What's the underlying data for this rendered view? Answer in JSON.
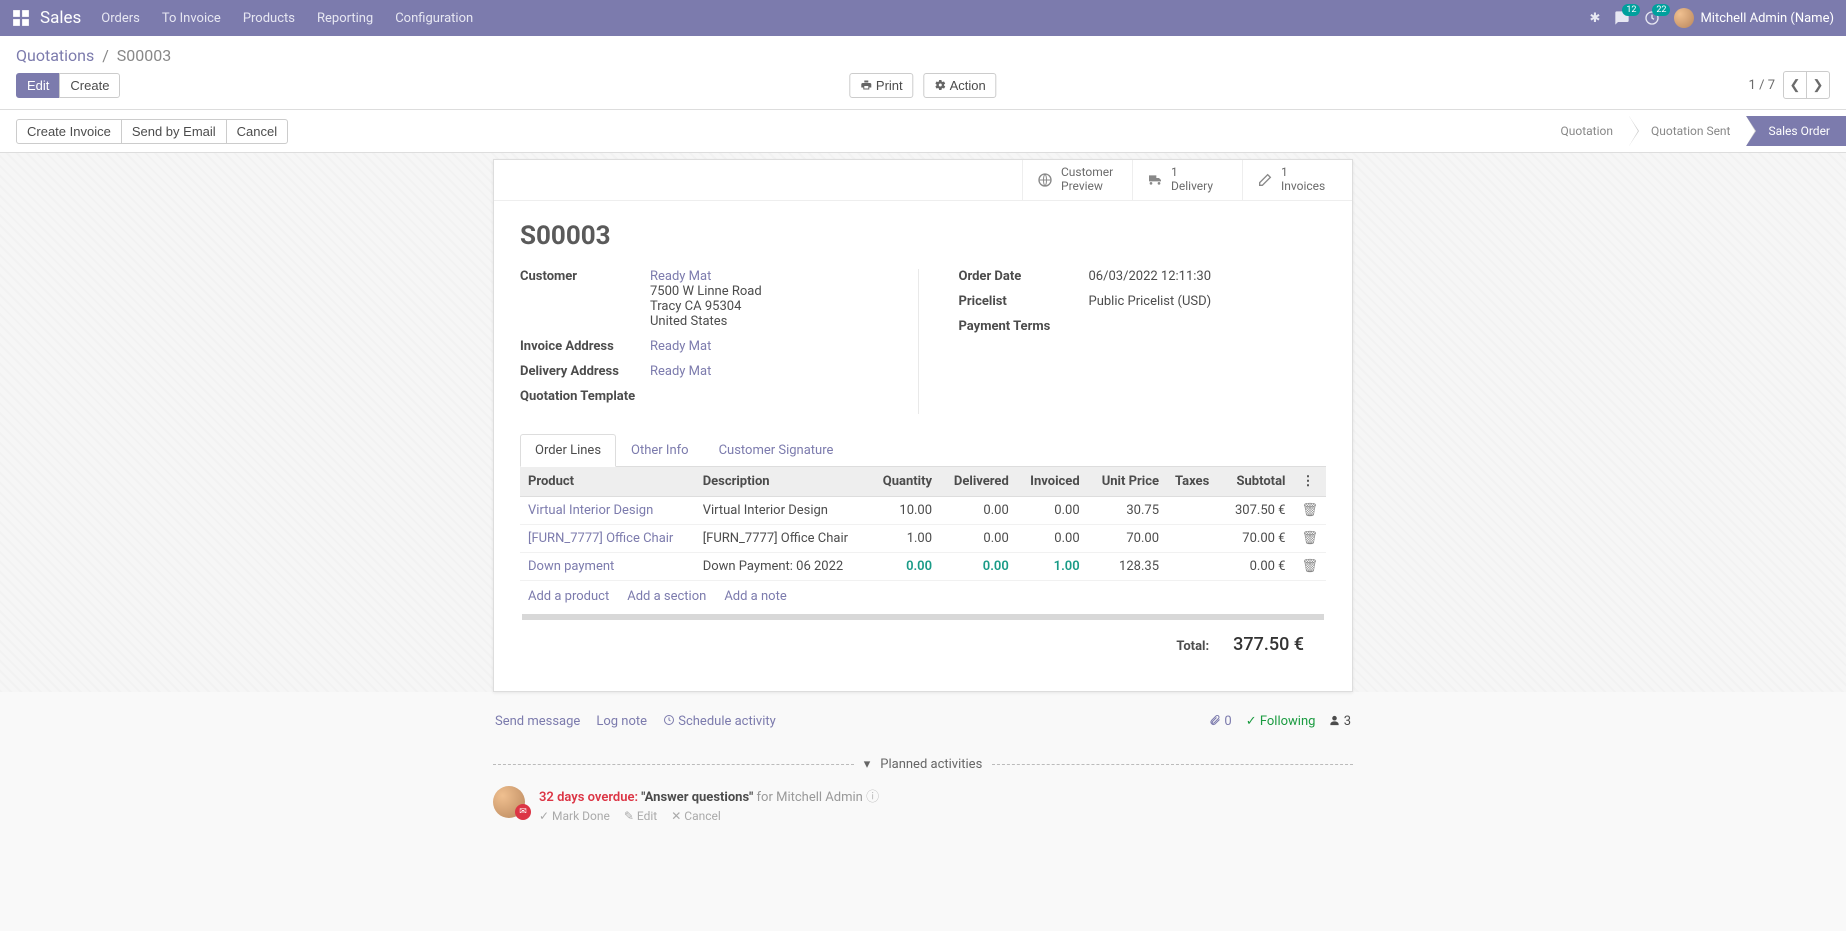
{
  "nav": {
    "brand": "Sales",
    "menu": [
      "Orders",
      "To Invoice",
      "Products",
      "Reporting",
      "Configuration"
    ],
    "msg_count": "12",
    "act_count": "22",
    "user": "Mitchell Admin (Name)"
  },
  "breadcrumb": {
    "root": "Quotations",
    "current": "S00003"
  },
  "controls": {
    "edit": "Edit",
    "create": "Create",
    "print": "Print",
    "action": "Action",
    "pager_pos": "1",
    "pager_total": "7"
  },
  "statusbar": {
    "create_invoice": "Create Invoice",
    "send_email": "Send by Email",
    "cancel": "Cancel",
    "steps": [
      "Quotation",
      "Quotation Sent",
      "Sales Order"
    ],
    "active_step": 2
  },
  "stat_btns": {
    "preview_label": "Customer\nPreview",
    "delivery_count": "1",
    "delivery_label": "Delivery",
    "invoice_count": "1",
    "invoice_label": "Invoices"
  },
  "order": {
    "name": "S00003",
    "customer_label": "Customer",
    "customer_link": "Ready Mat",
    "addr1": "7500 W Linne Road",
    "addr2": "Tracy CA 95304",
    "addr3": "United States",
    "invoice_addr_label": "Invoice Address",
    "invoice_addr": "Ready Mat",
    "delivery_addr_label": "Delivery Address",
    "delivery_addr": "Ready Mat",
    "template_label": "Quotation Template",
    "order_date_label": "Order Date",
    "order_date": "06/03/2022 12:11:30",
    "pricelist_label": "Pricelist",
    "pricelist": "Public Pricelist (USD)",
    "payment_terms_label": "Payment Terms"
  },
  "tabs": {
    "lines": "Order Lines",
    "other": "Other Info",
    "sig": "Customer Signature"
  },
  "table": {
    "headers": {
      "product": "Product",
      "desc": "Description",
      "qty": "Quantity",
      "del": "Delivered",
      "inv": "Invoiced",
      "price": "Unit Price",
      "tax": "Taxes",
      "sub": "Subtotal"
    },
    "rows": [
      {
        "product": "Virtual Interior Design",
        "desc": "Virtual Interior Design",
        "qty": "10.00",
        "del": "0.00",
        "inv": "0.00",
        "price": "30.75",
        "sub": "307.50 €",
        "hl": false
      },
      {
        "product": "[FURN_7777] Office Chair",
        "desc": "[FURN_7777] Office Chair",
        "qty": "1.00",
        "del": "0.00",
        "inv": "0.00",
        "price": "70.00",
        "sub": "70.00 €",
        "hl": false
      },
      {
        "product": "Down payment",
        "desc": "Down Payment: 06 2022",
        "qty": "0.00",
        "del": "0.00",
        "inv": "1.00",
        "price": "128.35",
        "sub": "0.00 €",
        "hl": true
      }
    ],
    "add_product": "Add a product",
    "add_section": "Add a section",
    "add_note": "Add a note",
    "total_label": "Total:",
    "total": "377.50 €"
  },
  "chatter": {
    "send": "Send message",
    "log": "Log note",
    "schedule": "Schedule activity",
    "attach": "0",
    "following": "Following",
    "followers": "3",
    "planned": "Planned activities",
    "activity": {
      "overdue": "32 days overdue:",
      "title": "\"Answer questions\"",
      "for": "for Mitchell Admin",
      "mark": "Mark Done",
      "edit": "Edit",
      "cancel": "Cancel"
    }
  }
}
